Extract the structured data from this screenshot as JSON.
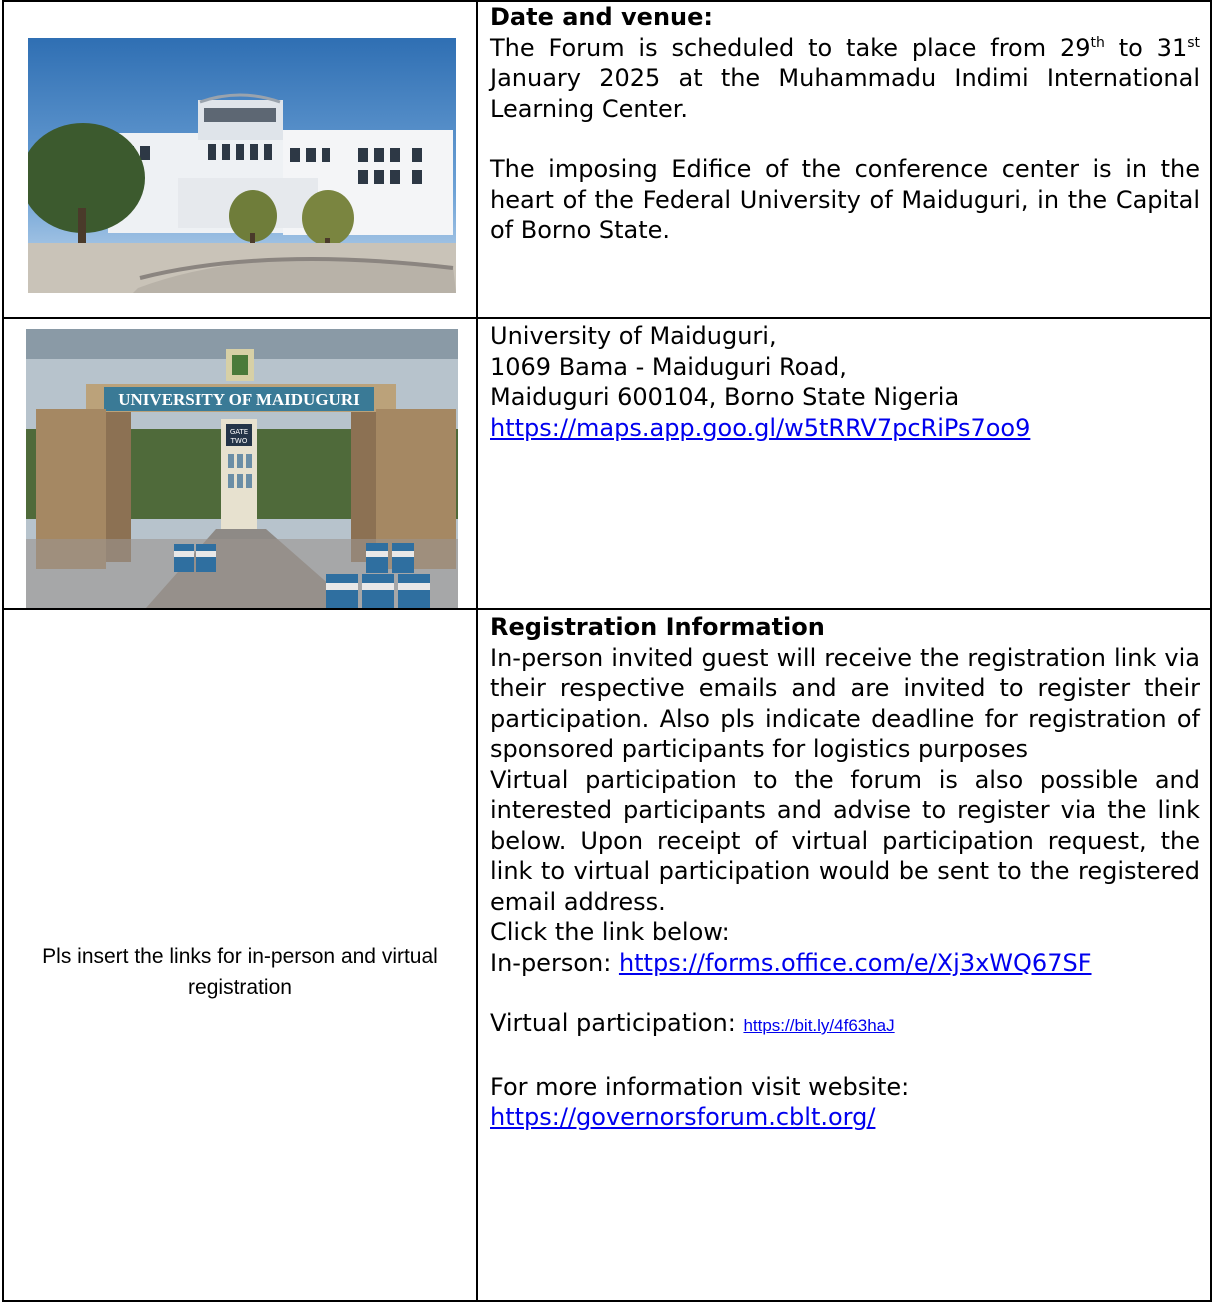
{
  "row1": {
    "heading": "Date and venue:",
    "p1": {
      "a": "The Forum is scheduled to take place from 29",
      "sup1": "th",
      "b": " to 31",
      "sup2": "st",
      "c": " January 2025 at the Muhammadu Indimi International Learning Center."
    },
    "p2": "The imposing Edifice of the conference center is in the heart of the Federal University of Maiduguri, in the Capital of Borno State."
  },
  "row2": {
    "sign_text": "UNIVERSITY OF MAIDUGURI",
    "gate_label_1": "GATE",
    "gate_label_2": "TWO",
    "line1": "University of Maiduguri,",
    "line2": "1069 Bama - Maiduguri Road,",
    "line3": "Maiduguri 600104, Borno State Nigeria",
    "map_link": "https://maps.app.goo.gl/w5tRRV7pcRiPs7oo9"
  },
  "row3": {
    "left_note": "Pls insert the links for in-person and virtual registration",
    "heading": "Registration Information",
    "p1": "In-person invited guest will receive the registration link via their respective emails and are invited to register their participation. Also pls indicate deadline for registration of sponsored participants for logistics purposes",
    "p2": "Virtual participation to the forum is also possible and interested participants and advise to register via the link below. Upon receipt of virtual participation request, the link to virtual participation would be sent to the registered email address.",
    "click_line": "Click the link below:",
    "inperson_label": "In-person: ",
    "inperson_link": "https://forms.office.com/e/Xj3xWQ67SF",
    "virtual_label": "Virtual participation: ",
    "virtual_link": "https://bit.ly/4f63haJ",
    "website_label": "For more information visit website:",
    "website_link": "https://governorsforum.cblt.org/"
  }
}
